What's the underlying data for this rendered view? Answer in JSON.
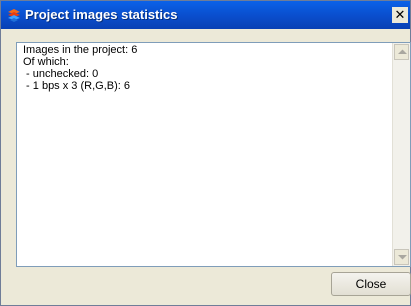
{
  "window": {
    "title": "Project images statistics",
    "close_glyph": "✕"
  },
  "content": {
    "lines": [
      "Images in the project: 6",
      "Of which:",
      " - unchecked: 0",
      " - 1 bps x 3 (R,G,B): 6"
    ]
  },
  "buttons": {
    "close_label": "Close"
  },
  "icons": {
    "app": "app-logo-icon",
    "scroll_up": "scroll-up-arrow-icon",
    "scroll_down": "scroll-down-arrow-icon"
  },
  "colors": {
    "titlebar": "#0a4dcc",
    "dialog_background": "#ece9d8",
    "text_border": "#7f9db9"
  }
}
